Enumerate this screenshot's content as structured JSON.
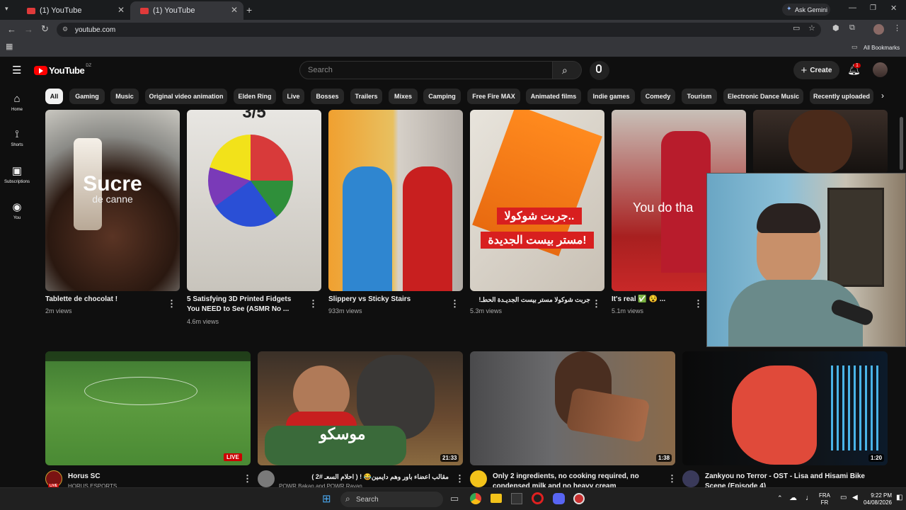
{
  "browser": {
    "tabs": [
      {
        "title": "(1) YouTube"
      },
      {
        "title": "(1) YouTube"
      }
    ],
    "url": "youtube.com",
    "ask_gemini": "Ask Gemini",
    "all_bookmarks": "All Bookmarks"
  },
  "youtube": {
    "logo": "YouTube",
    "country": "DZ",
    "search_placeholder": "Search",
    "create": "Create",
    "notifications": "1"
  },
  "sidebar": [
    {
      "label": "Home",
      "icon": "home-icon"
    },
    {
      "label": "Shorts",
      "icon": "shorts-icon"
    },
    {
      "label": "Subscriptions",
      "icon": "subscriptions-icon"
    },
    {
      "label": "You",
      "icon": "you-icon"
    }
  ],
  "chips": [
    "All",
    "Gaming",
    "Music",
    "Original video animation",
    "Elden Ring",
    "Live",
    "Bosses",
    "Trailers",
    "Mixes",
    "Camping",
    "Free Fire MAX",
    "Animated films",
    "Indie games",
    "Comedy",
    "Tourism",
    "Electronic Dance Music",
    "Recently uploaded"
  ],
  "shorts": [
    {
      "title": "Tablette de chocolat !",
      "title2": "",
      "views": "2m views",
      "overlay": "Sucre",
      "overlay2": "de canne"
    },
    {
      "title": "5 Satisfying 3D Printed Fidgets",
      "title2": "You NEED to See (ASMR No ...",
      "views": "4.6m views",
      "overlay": "3/5",
      "overlay2": ""
    },
    {
      "title": "Slippery vs Sticky Stairs",
      "title2": "",
      "views": "933m views",
      "overlay": "",
      "overlay2": ""
    },
    {
      "title": "!جربت شوكولا مستر بيست الجديـدة الحطـ",
      "title2": "",
      "views": "5.3m views",
      "overlay": "جربت شوكولا..",
      "overlay2": "مستر بيست الجديدة!"
    },
    {
      "title": "It's real ✅ 😵 ...",
      "title2": "",
      "views": "5.1m views",
      "overlay": "You do tha",
      "overlay2": ""
    }
  ],
  "videos": [
    {
      "title": "Horus SC",
      "title2": "",
      "channel": "HORUS ESPORTS",
      "badge": "LIVE",
      "avatar_badge": "LIVE"
    },
    {
      "title": "مقالب اعضاء باور وهم دايمين😂 ! ( احلام السعـ #2 )",
      "title2": "",
      "channel": "POWR Bakan and POWR Rayan",
      "badge": "21:33",
      "overlay": "موسكو"
    },
    {
      "title": "Only 2 ingredients, no cooking required, no",
      "title2": "condensed milk and no heavy cream",
      "channel": "",
      "badge": "1:38"
    },
    {
      "title": "Zankyou no Terror - OST - Lisa and Hisami Bike",
      "title2": "Scene (Episode 4)",
      "channel": "",
      "badge": "1:20"
    }
  ],
  "taskbar": {
    "search": "Search",
    "lang1": "FRA",
    "lang2": "FR",
    "time": "9:22 PM",
    "date": "04/08/2026"
  },
  "colors": {
    "bg": "#0f0f0f",
    "chip": "#272727",
    "red": "#ff0000"
  }
}
